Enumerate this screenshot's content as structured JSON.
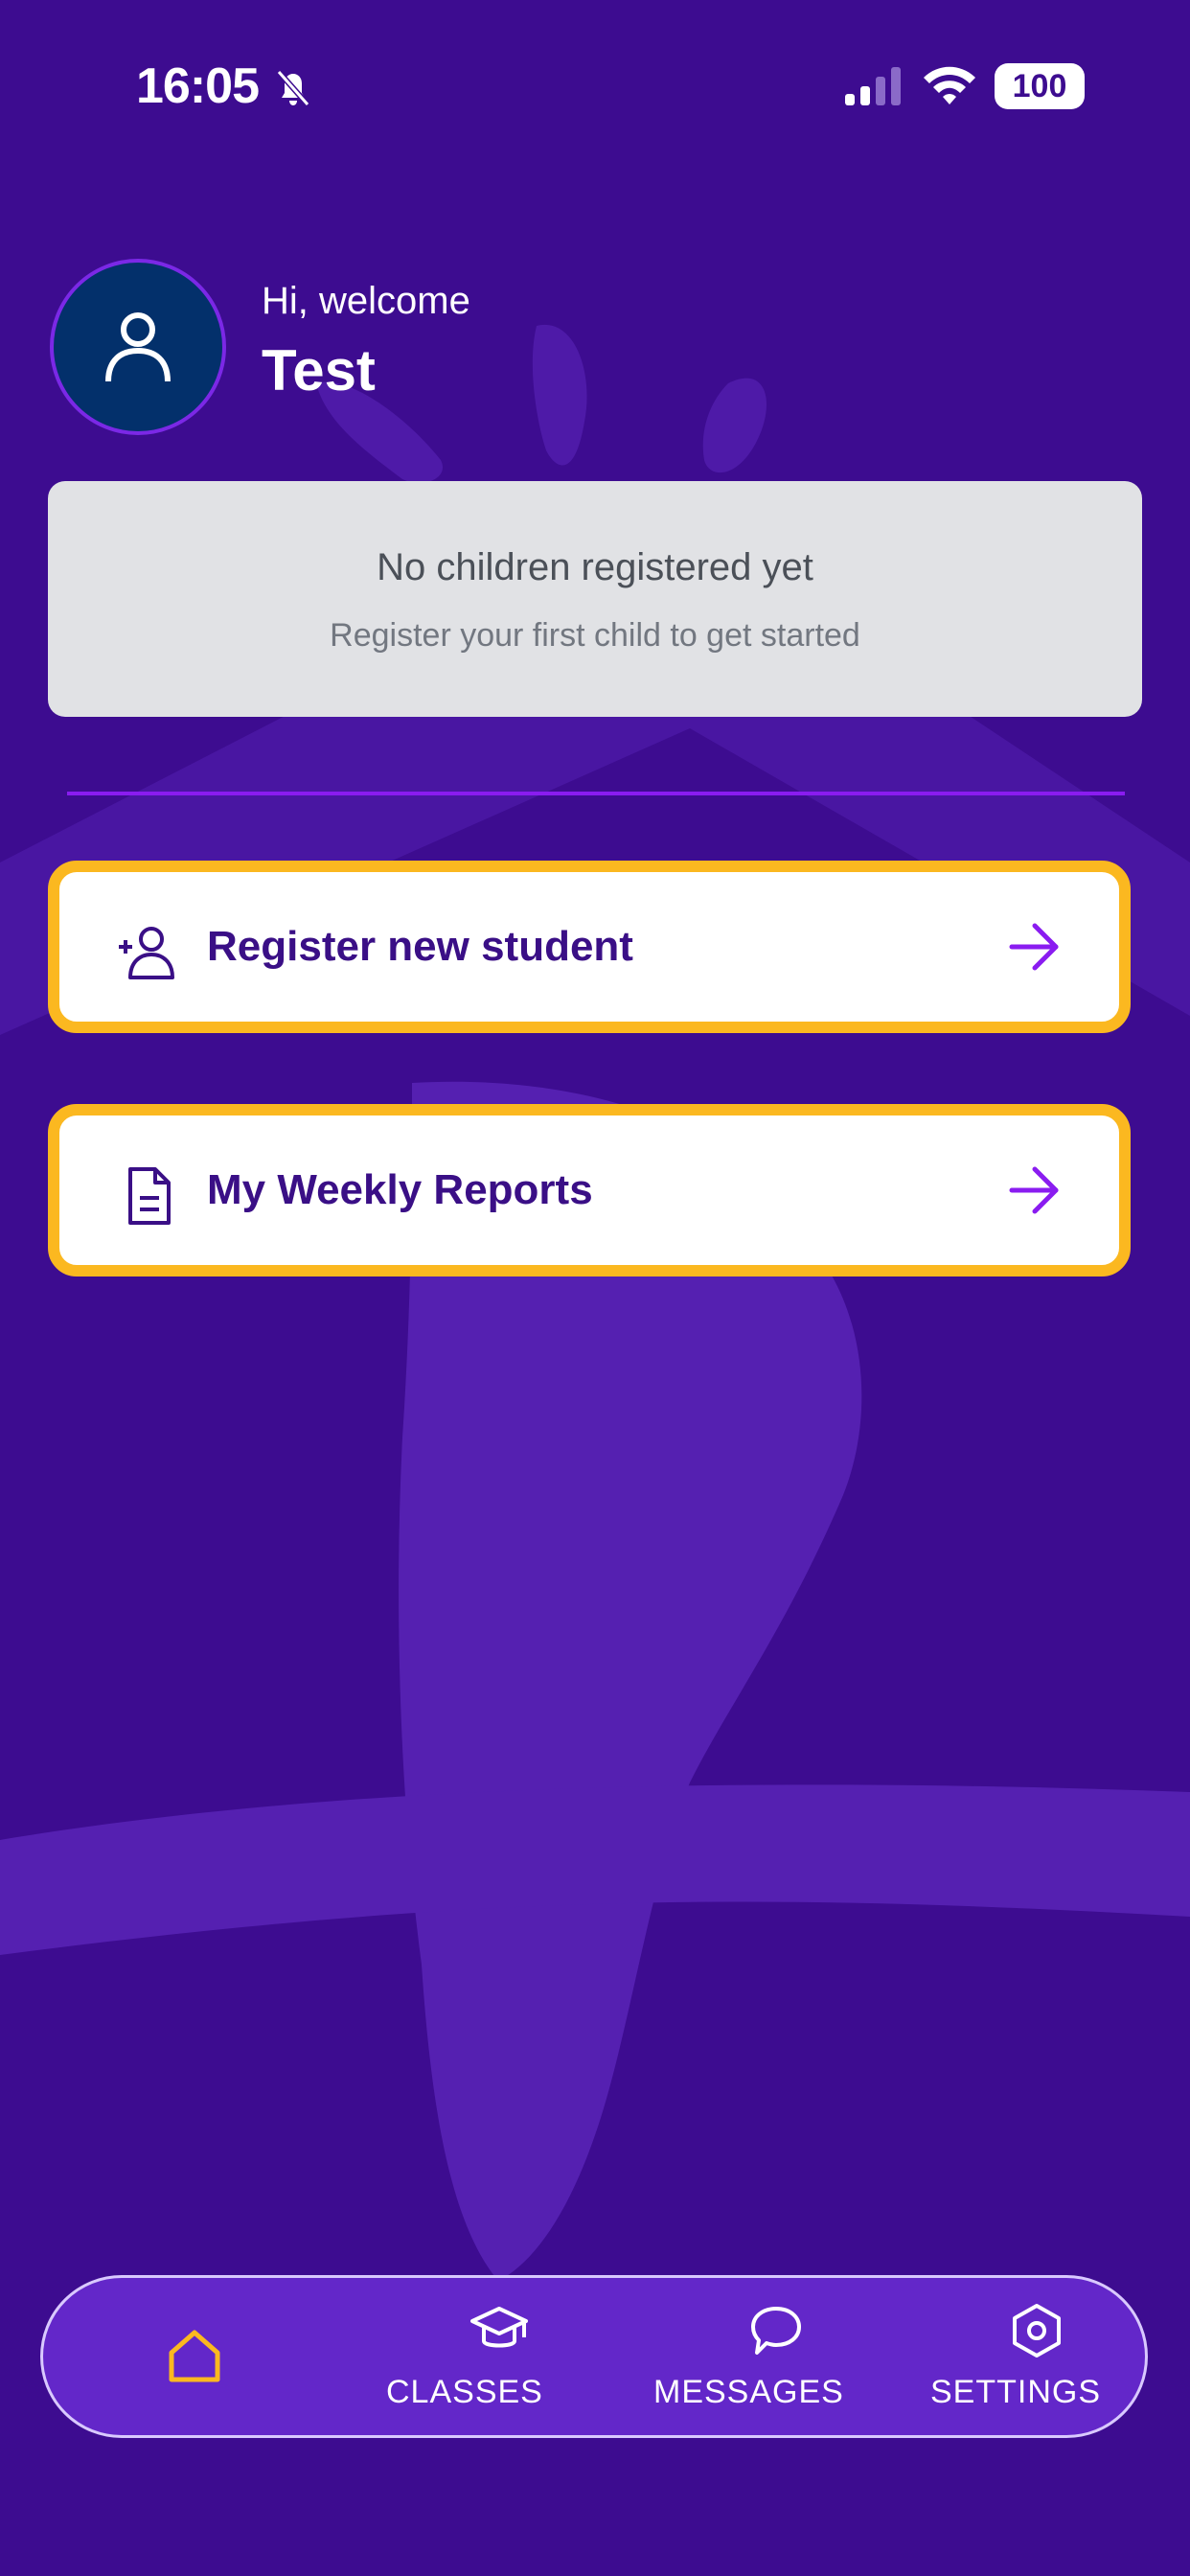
{
  "status_bar": {
    "time": "16:05",
    "battery": "100",
    "icons": [
      "bell-off-icon",
      "signal-icon",
      "wifi-icon",
      "battery-icon"
    ]
  },
  "header": {
    "greeting": "Hi, welcome",
    "user_name": "Test",
    "avatar_icon": "user-icon"
  },
  "empty_state": {
    "title": "No children registered yet",
    "subtitle": "Register your first child to get started"
  },
  "actions": [
    {
      "label": "Register new student",
      "icon": "user-plus-icon"
    },
    {
      "label": "My Weekly Reports",
      "icon": "document-icon"
    }
  ],
  "bottom_nav": {
    "items": [
      {
        "label": "",
        "icon": "home-icon",
        "active": true
      },
      {
        "label": "CLASSES",
        "icon": "graduation-cap-icon"
      },
      {
        "label": "MESSAGES",
        "icon": "chat-bubble-icon"
      },
      {
        "label": "SETTINGS",
        "icon": "settings-icon"
      }
    ]
  },
  "colors": {
    "background": "#3d0c90",
    "card_border": "#fbb820",
    "accent_purple": "#8a1cf0",
    "active_nav": "#fbb820"
  }
}
